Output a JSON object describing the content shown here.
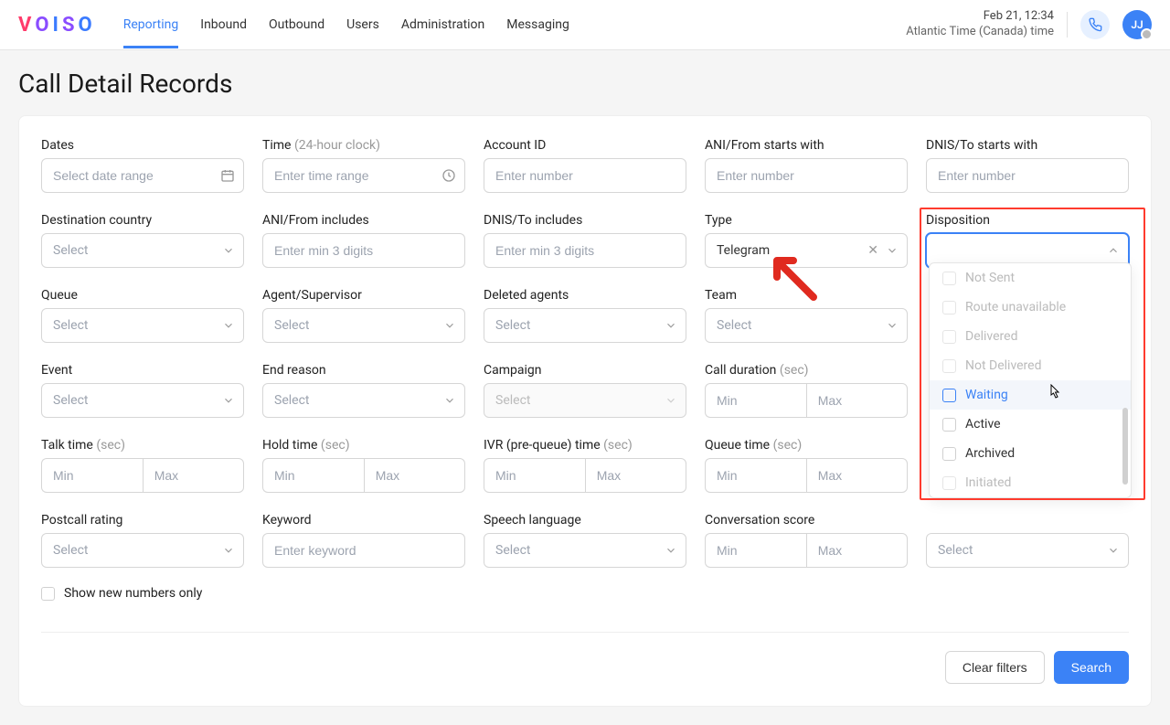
{
  "header": {
    "logo": "VOISO",
    "nav": [
      "Reporting",
      "Inbound",
      "Outbound",
      "Users",
      "Administration",
      "Messaging"
    ],
    "active_nav": 0,
    "date": "Feb 21, 12:34",
    "tz": "Atlantic Time (Canada) time",
    "avatar": "JJ"
  },
  "page": {
    "title": "Call Detail Records"
  },
  "filters": {
    "dates": {
      "label": "Dates",
      "placeholder": "Select date range"
    },
    "time": {
      "label": "Time",
      "hint": "(24-hour clock)",
      "placeholder": "Enter time range"
    },
    "account": {
      "label": "Account ID",
      "placeholder": "Enter number"
    },
    "ani_from_starts": {
      "label": "ANI/From starts with",
      "placeholder": "Enter number"
    },
    "dnis_to_starts": {
      "label": "DNIS/To starts with",
      "placeholder": "Enter number"
    },
    "dest_country": {
      "label": "Destination country",
      "placeholder": "Select"
    },
    "ani_from_incl": {
      "label": "ANI/From includes",
      "placeholder": "Enter min 3 digits"
    },
    "dnis_to_incl": {
      "label": "DNIS/To includes",
      "placeholder": "Enter min 3 digits"
    },
    "type": {
      "label": "Type",
      "value": "Telegram"
    },
    "disposition": {
      "label": "Disposition"
    },
    "queue": {
      "label": "Queue",
      "placeholder": "Select"
    },
    "agent": {
      "label": "Agent/Supervisor",
      "placeholder": "Select"
    },
    "deleted_agents": {
      "label": "Deleted agents",
      "placeholder": "Select"
    },
    "team": {
      "label": "Team",
      "placeholder": "Select"
    },
    "event": {
      "label": "Event",
      "placeholder": "Select"
    },
    "end_reason": {
      "label": "End reason",
      "placeholder": "Select"
    },
    "campaign": {
      "label": "Campaign",
      "placeholder": "Select"
    },
    "call_duration": {
      "label": "Call duration",
      "hint": "(sec)",
      "min": "Min",
      "max": "Max"
    },
    "talk_time": {
      "label": "Talk time",
      "hint": "(sec)",
      "min": "Min",
      "max": "Max"
    },
    "hold_time": {
      "label": "Hold time",
      "hint": "(sec)",
      "min": "Min",
      "max": "Max"
    },
    "ivr_time": {
      "label": "IVR (pre-queue) time",
      "hint": "(sec)",
      "min": "Min",
      "max": "Max"
    },
    "queue_time": {
      "label": "Queue time",
      "hint": "(sec)",
      "min": "Min",
      "max": "Max"
    },
    "postcall": {
      "label": "Postcall rating",
      "placeholder": "Select"
    },
    "keyword": {
      "label": "Keyword",
      "placeholder": "Enter keyword"
    },
    "speech_lang": {
      "label": "Speech language",
      "placeholder": "Select"
    },
    "conv_score": {
      "label": "Conversation score",
      "min": "Min",
      "max": "Max"
    },
    "hidden_select": {
      "placeholder": "Select"
    }
  },
  "disposition_options": [
    {
      "label": "Not Sent",
      "disabled": true
    },
    {
      "label": "Route unavailable",
      "disabled": true
    },
    {
      "label": "Delivered",
      "disabled": true
    },
    {
      "label": "Not Delivered",
      "disabled": true
    },
    {
      "label": "Waiting",
      "disabled": false,
      "hover": true
    },
    {
      "label": "Active",
      "disabled": false
    },
    {
      "label": "Archived",
      "disabled": false
    },
    {
      "label": "Initiated",
      "disabled": true
    }
  ],
  "show_new_numbers": "Show new numbers only",
  "buttons": {
    "clear": "Clear filters",
    "search": "Search"
  }
}
